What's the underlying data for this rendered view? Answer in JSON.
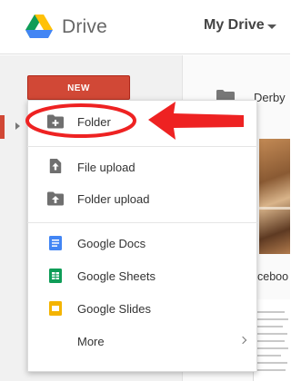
{
  "header": {
    "app_title": "Drive",
    "location_label": "My Drive",
    "logo_icon": "google-drive-logo"
  },
  "sidebar": {
    "new_button_label": "NEW"
  },
  "content": {
    "file_name": "Derby",
    "thumb_label": "ceboo"
  },
  "new_menu": {
    "items": [
      {
        "label": "Folder",
        "icon": "new-folder-icon"
      },
      {
        "label": "File upload",
        "icon": "file-upload-icon"
      },
      {
        "label": "Folder upload",
        "icon": "folder-upload-icon"
      },
      {
        "label": "Google Docs",
        "icon": "google-docs-icon"
      },
      {
        "label": "Google Sheets",
        "icon": "google-sheets-icon"
      },
      {
        "label": "Google Slides",
        "icon": "google-slides-icon"
      },
      {
        "label": "More",
        "icon": "chevron-right-icon"
      }
    ]
  },
  "colors": {
    "new_button": "#d14836",
    "annotation": "#ee2222",
    "docs": "#4285f4",
    "sheets": "#0f9d58",
    "slides": "#f4b400"
  }
}
